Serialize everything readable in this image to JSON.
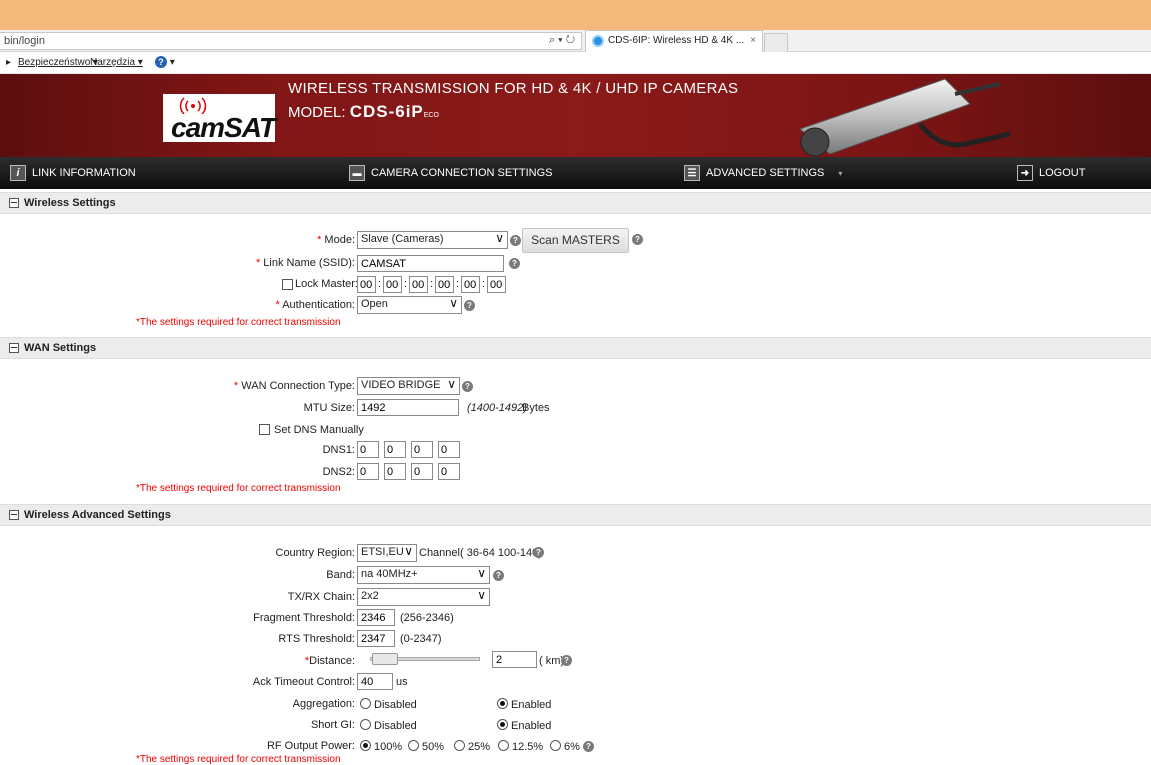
{
  "browser": {
    "address": "bin/login",
    "address_icons": "⌕ ▾ ↻",
    "tab_title": "CDS-6IP: Wireless HD & 4K ...",
    "tab_close": "×",
    "menu": [
      "Bezpieczeństwo ▾",
      "Narzędzia ▾"
    ],
    "help_icon": "?"
  },
  "banner": {
    "logo_text": "camSAT",
    "title": "WIRELESS TRANSMISSION FOR HD & 4K / UHD IP CAMERAS",
    "model_label": "MODEL: ",
    "model_value": "CDS-6iP",
    "model_suffix": "ECO"
  },
  "nav": {
    "link_info": "LINK INFORMATION",
    "camera": "CAMERA CONNECTION SETTINGS",
    "advanced": "ADVANCED SETTINGS",
    "logout": "LOGOUT",
    "advanced_caret": "▾"
  },
  "wireless": {
    "header": "Wireless Settings",
    "mode_label": "Mode:",
    "mode_value": "Slave (Cameras)",
    "scan_button": "Scan MASTERS",
    "ssid_label": "Link Name (SSID):",
    "ssid_value": "CAMSAT",
    "lock_master_label": "Lock Master:",
    "mac": [
      "00",
      "00",
      "00",
      "00",
      "00",
      "00"
    ],
    "auth_label": "Authentication:",
    "auth_value": "Open",
    "note": "*The settings required for correct transmission"
  },
  "wan": {
    "header": "WAN Settings",
    "type_label": "WAN Connection Type:",
    "type_value": "VIDEO BRIDGE",
    "mtu_label": "MTU Size:",
    "mtu_value": "1492",
    "mtu_range": "(1400-1492)",
    "mtu_unit": "Bytes",
    "dns_manual_label": "Set DNS Manually",
    "dns1_label": "DNS1:",
    "dns1": [
      "0",
      "0",
      "0",
      "0"
    ],
    "dns2_label": "DNS2:",
    "dns2": [
      "0",
      "0",
      "0",
      "0"
    ],
    "note": "*The settings required for correct transmission"
  },
  "advanced": {
    "header": "Wireless Advanced Settings",
    "country_label": "Country Region:",
    "country_value": "ETSI,EU",
    "channel_text": "Channel( 36-64 100-140)",
    "band_label": "Band:",
    "band_value": "na 40MHz+",
    "chain_label": "TX/RX Chain:",
    "chain_value": "2x2",
    "frag_label": "Fragment Threshold:",
    "frag_value": "2346",
    "frag_range": "(256-2346)",
    "rts_label": "RTS Threshold:",
    "rts_value": "2347",
    "rts_range": "(0-2347)",
    "distance_label": "Distance:",
    "distance_value": "2",
    "distance_unit": "( km)",
    "distance_slider_level": 0.05,
    "ack_label": "Ack Timeout Control:",
    "ack_value": "40",
    "ack_unit": "us",
    "aggregation_label": "Aggregation:",
    "short_gi_label": "Short GI:",
    "disabled": "Disabled",
    "enabled": "Enabled",
    "rf_label": "RF Output Power:",
    "rf_options": [
      "100%",
      "50%",
      "25%",
      "12.5%",
      "6%"
    ],
    "rf_selected": "100%",
    "note": "*The settings required for correct transmission"
  },
  "common": {
    "required_mark": "*",
    "select_arrow": "∨",
    "help_mark": "?"
  }
}
